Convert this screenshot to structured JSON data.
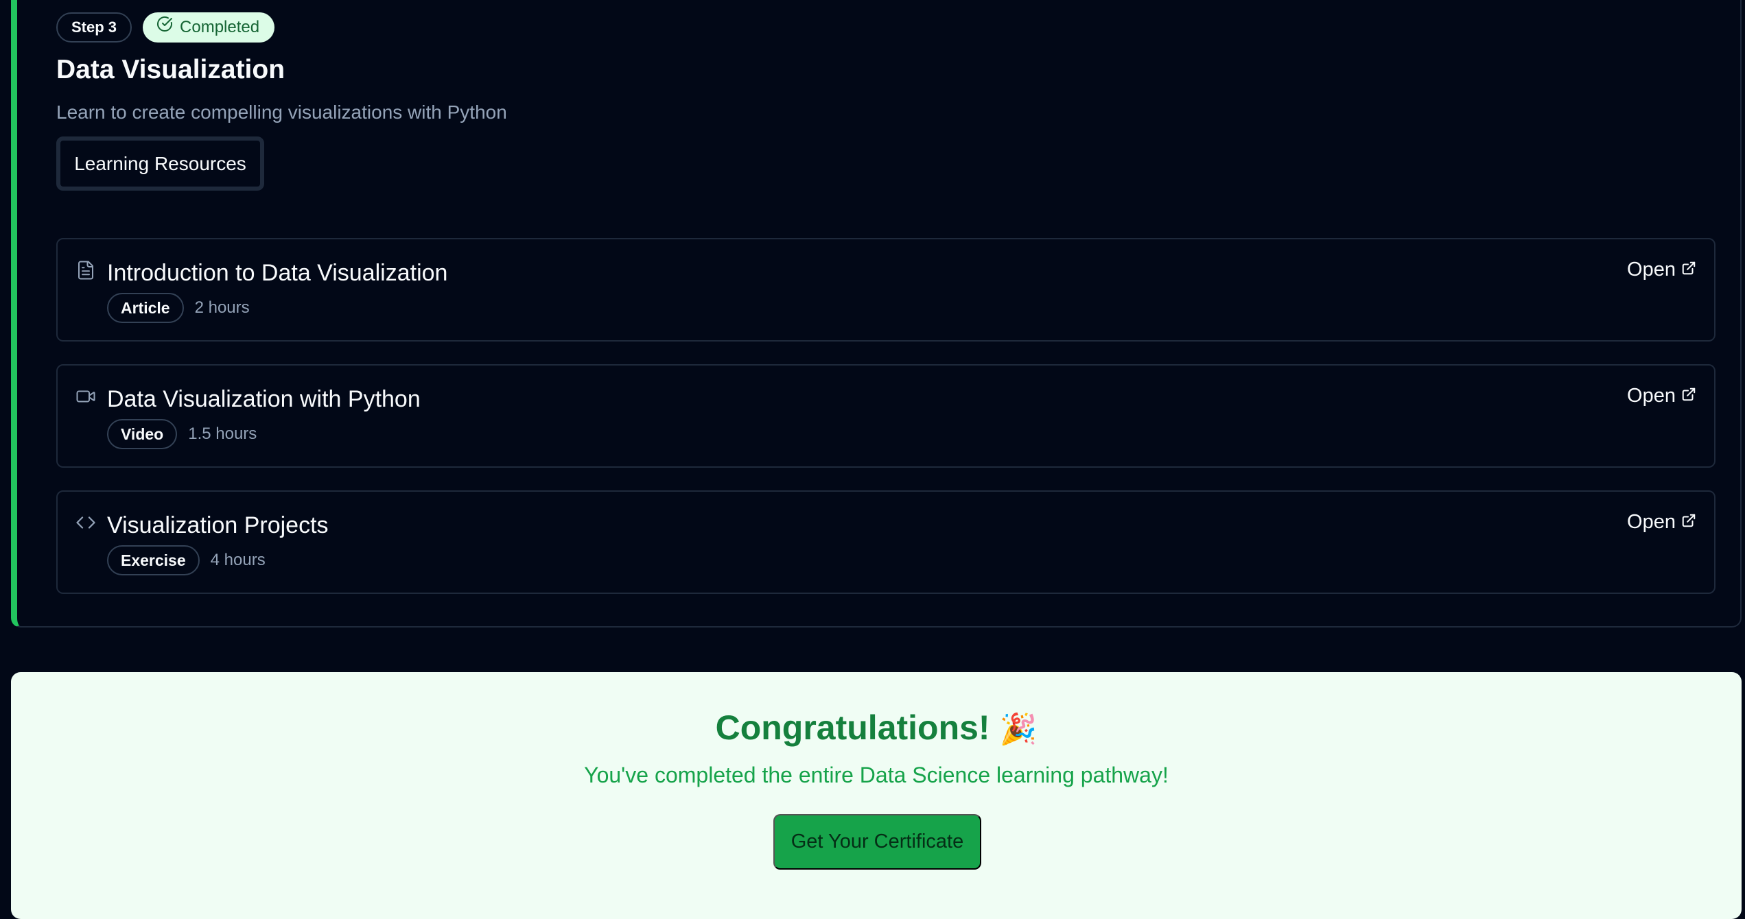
{
  "step": {
    "step_label": "Step 3",
    "status_label": "Completed",
    "title": "Data Visualization",
    "description": "Learn to create compelling visualizations with Python",
    "resources_button": "Learning Resources",
    "accent_color": "#22c55e"
  },
  "resources": [
    {
      "icon": "document-icon",
      "title": "Introduction to Data Visualization",
      "type": "Article",
      "duration": "2 hours",
      "action": "Open"
    },
    {
      "icon": "video-icon",
      "title": "Data Visualization with Python",
      "type": "Video",
      "duration": "1.5 hours",
      "action": "Open"
    },
    {
      "icon": "code-icon",
      "title": "Visualization Projects",
      "type": "Exercise",
      "duration": "4 hours",
      "action": "Open"
    }
  ],
  "completion": {
    "title": "Congratulations!",
    "emoji": "🎉",
    "message": "You've completed the entire Data Science learning pathway!",
    "certificate_button": "Get Your Certificate",
    "accent_color": "#16a34a"
  }
}
